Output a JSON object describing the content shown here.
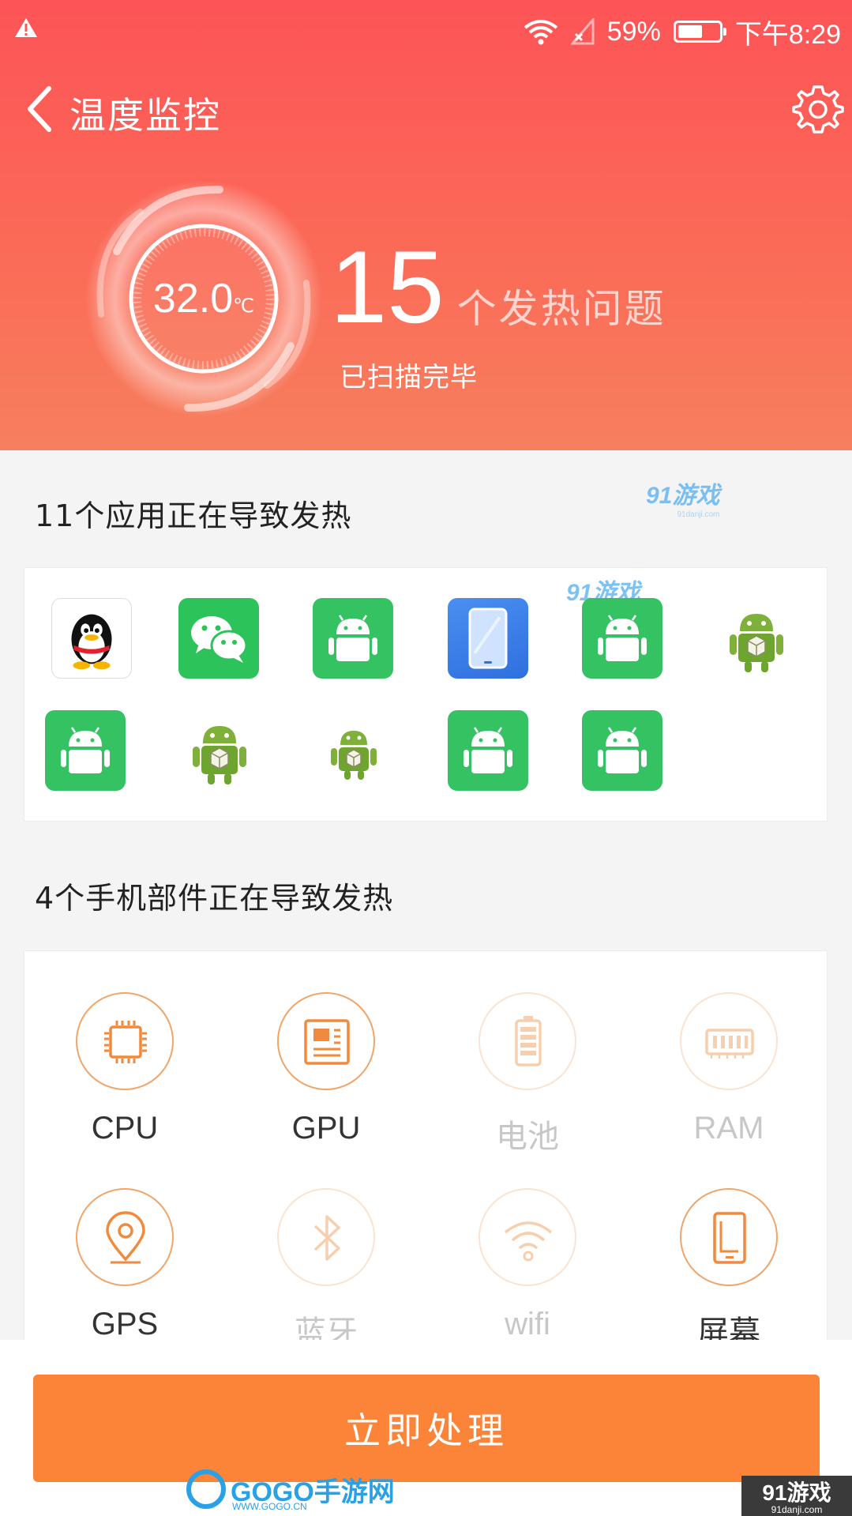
{
  "status_bar": {
    "battery_percent": "59%",
    "time": "下午8:29",
    "icons": [
      "warning-icon",
      "wifi-icon",
      "signal-icon",
      "battery-icon"
    ]
  },
  "header": {
    "title": "温度监控",
    "temperature": "32.0",
    "temperature_unit": "℃",
    "issue_count": "15",
    "issue_text": "个发热问题",
    "scan_status": "已扫描完毕"
  },
  "apps_section": {
    "title": "11个应用正在导致发热",
    "apps": [
      {
        "icon": "qq-icon"
      },
      {
        "icon": "wechat-icon"
      },
      {
        "icon": "android-app-icon"
      },
      {
        "icon": "tablet-app-icon"
      },
      {
        "icon": "android-app-icon"
      },
      {
        "icon": "android-robot-icon"
      },
      {
        "icon": "android-app-icon"
      },
      {
        "icon": "android-robot-icon"
      },
      {
        "icon": "android-robot-icon"
      },
      {
        "icon": "android-app-icon"
      },
      {
        "icon": "android-app-icon"
      }
    ]
  },
  "parts_section": {
    "title": "4个手机部件正在导致发热",
    "parts": [
      {
        "label": "CPU",
        "icon": "cpu-icon",
        "active": true
      },
      {
        "label": "GPU",
        "icon": "gpu-icon",
        "active": true
      },
      {
        "label": "电池",
        "icon": "battery-part-icon",
        "active": false
      },
      {
        "label": "RAM",
        "icon": "ram-icon",
        "active": false
      },
      {
        "label": "GPS",
        "icon": "gps-icon",
        "active": true
      },
      {
        "label": "蓝牙",
        "icon": "bluetooth-icon",
        "active": false
      },
      {
        "label": "wifi",
        "icon": "wifi-part-icon",
        "active": false
      },
      {
        "label": "屏幕",
        "icon": "screen-icon",
        "active": true
      }
    ]
  },
  "action_button": "立即处理",
  "watermarks": {
    "gogo": "GOGO手游网",
    "gogo_url": "WWW.GOGO.CN",
    "danji": "91游戏",
    "danji_url": "91danji.com"
  },
  "colors": {
    "header_top": "#fd5457",
    "header_bottom": "#f77f5e",
    "accent_orange": "#fb8438",
    "part_active": "#f0a56b",
    "part_inactive": "#fbe3d2",
    "app_green": "#35c263"
  }
}
